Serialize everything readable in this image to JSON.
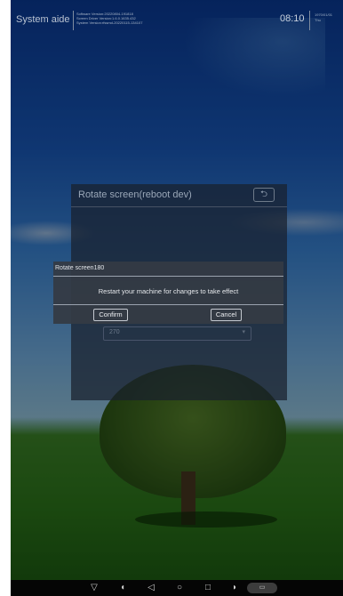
{
  "statusbar": {
    "app_title": "System aide",
    "versions": [
      "Software Version:20220804-191818",
      "Screen Driver Version:1.6.0.1635.432",
      "System Version:rfssmd-20220115-134107"
    ],
    "time": "08:10",
    "date": "1970/01/01",
    "weekday": "Thu"
  },
  "panel": {
    "title": "Rotate screen(reboot dev)",
    "back_icon": "return-icon",
    "back_glyph": "⮌",
    "option_value": "270",
    "option_arrow": "▾"
  },
  "dialog": {
    "title": "Rotate screen180",
    "message": "Restart your machine for changes to take effect",
    "confirm_label": "Confirm",
    "cancel_label": "Cancel"
  },
  "navbar": {
    "items": [
      {
        "icon": "hide-navbar-icon",
        "glyph": "▽"
      },
      {
        "icon": "volume-down-icon",
        "glyph": "◖"
      },
      {
        "icon": "back-icon",
        "glyph": "◁"
      },
      {
        "icon": "home-icon",
        "glyph": "○"
      },
      {
        "icon": "recents-icon",
        "glyph": "□"
      },
      {
        "icon": "volume-up-icon",
        "glyph": "◗"
      }
    ],
    "screenshot_icon": "screenshot-icon",
    "screenshot_glyph": "▭"
  }
}
